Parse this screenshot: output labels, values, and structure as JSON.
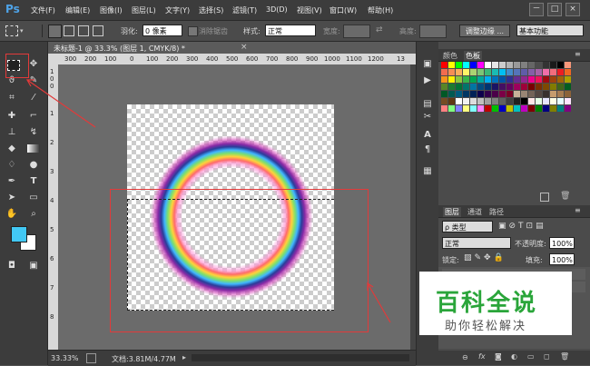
{
  "app": {
    "logo": "Ps"
  },
  "menubar": {
    "items": [
      "文件(F)",
      "编辑(E)",
      "图像(I)",
      "图层(L)",
      "文字(Y)",
      "选择(S)",
      "滤镜(T)",
      "3D(D)",
      "视图(V)",
      "窗口(W)",
      "帮助(H)"
    ],
    "window_buttons": [
      "－",
      "□",
      "×"
    ]
  },
  "options": {
    "feather_label": "羽化:",
    "feather_value": "0 像素",
    "antialias_label": "消除锯齿",
    "style_label": "样式:",
    "style_value": "正常",
    "width_label": "宽度:",
    "height_label": "高度:",
    "refine_edge": "调整边缘 ...",
    "workspace": "基本功能"
  },
  "document": {
    "tab_title": "未标题-1 @ 33.3% (图层 1, CMYK/8) *",
    "ruler_h": [
      "300",
      "200",
      "100",
      "0",
      "100",
      "200",
      "300",
      "400",
      "500",
      "600",
      "700",
      "800",
      "900",
      "1000",
      "1100",
      "1200",
      "13"
    ],
    "ruler_v": [
      "1",
      "0",
      "0",
      "1",
      "2",
      "3",
      "4",
      "5",
      "6",
      "7",
      "8"
    ],
    "zoom": "33.33%",
    "doc_info": "文档:3.81M/4.77M"
  },
  "swatches_panel": {
    "tabs": [
      "颜色",
      "色板"
    ],
    "colors": [
      [
        "#ff0000",
        "#ffff00",
        "#00ff00",
        "#00ffff",
        "#0000ff",
        "#ff00ff",
        "#ffffff",
        "#e6e6e6",
        "#cccccc",
        "#b3b3b3",
        "#999999",
        "#808080",
        "#666666",
        "#4d4d4d",
        "#333333",
        "#1a1a1a",
        "#000000",
        "#f7977a"
      ],
      [
        "#f26c4f",
        "#f68e55",
        "#fbaf5c",
        "#fff467",
        "#acd372",
        "#7cc576",
        "#3bb878",
        "#1abbb4",
        "#00bff3",
        "#438ccb",
        "#5574b9",
        "#605ca8",
        "#855fa8",
        "#a763a8",
        "#f06ea9",
        "#f26d7d",
        "#ed1c24",
        "#f26522"
      ],
      [
        "#f7941d",
        "#fff200",
        "#8dc73f",
        "#39b54a",
        "#00a651",
        "#00a99d",
        "#00aeef",
        "#0072bc",
        "#0054a6",
        "#2e3192",
        "#662d91",
        "#92278f",
        "#ec008c",
        "#ed145b",
        "#9e0b0f",
        "#a0410d",
        "#a36209",
        "#aba000"
      ],
      [
        "#598527",
        "#1a7b30",
        "#007236",
        "#00746b",
        "#0076a3",
        "#004b80",
        "#003471",
        "#1b1464",
        "#440e62",
        "#630460",
        "#9e005d",
        "#9e0039",
        "#790000",
        "#7b2e00",
        "#7d4900",
        "#827b00",
        "#406618",
        "#005e20"
      ],
      [
        "#005826",
        "#005952",
        "#005b7f",
        "#003663",
        "#002157",
        "#0d004c",
        "#32004b",
        "#4b0049",
        "#7b0046",
        "#7a0026",
        "#c7b299",
        "#998675",
        "#736357",
        "#534741",
        "#37302d",
        "#c69c6d",
        "#a67c52",
        "#8c6239"
      ],
      [
        "#754c24",
        "#603913",
        "#ffffff",
        "#f2f2f2",
        "#dcdcdc",
        "#c0c0c0",
        "#a0a0a0",
        "#808080",
        "#606060",
        "#404040",
        "#202020",
        "#000000",
        "#ffe6e6",
        "#e6ffe6",
        "#e6e6ff",
        "#ffffe6",
        "#e6ffff",
        "#ffe6ff"
      ],
      [
        "#ff8080",
        "#80ff80",
        "#8080ff",
        "#ffff80",
        "#80ffff",
        "#ff80ff",
        "#c00000",
        "#00c000",
        "#0000c0",
        "#c0c000",
        "#00c0c0",
        "#c000c0",
        "#800000",
        "#008000",
        "#000080",
        "#808000",
        "#008080",
        "#800080"
      ]
    ]
  },
  "layers_panel": {
    "tabs": [
      "图层",
      "通道",
      "路径"
    ],
    "filter_label": "ρ 类型",
    "blend_mode": "正常",
    "opacity_label": "不透明度:",
    "opacity_value": "100%",
    "lock_label": "锁定:",
    "fill_label": "填充:",
    "fill_value": "100%",
    "bottom_icons": [
      "链接",
      "fx",
      "蒙版",
      "调整",
      "组",
      "新建",
      "删除"
    ]
  },
  "watermark": {
    "title": "百科全说",
    "subtitle": "助你轻松解决"
  }
}
